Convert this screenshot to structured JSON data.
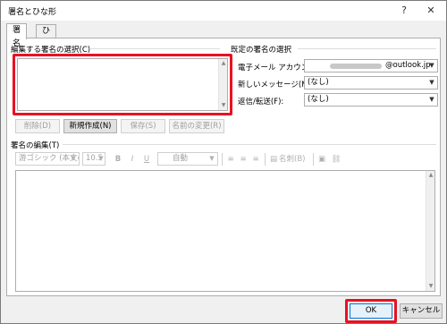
{
  "window": {
    "title": "署名とひな形",
    "help": "?",
    "close": "✕"
  },
  "tabs": [
    {
      "label": "署名"
    },
    {
      "label": "ひな形"
    }
  ],
  "select_section": {
    "title": "編集する署名の選択(C)",
    "buttons": {
      "delete": "削除(D)",
      "new": "新規作成(N)",
      "save": "保存(S)",
      "rename": "名前の変更(R)"
    }
  },
  "default_section": {
    "title": "既定の署名の選択",
    "email_label": "電子メール アカウント(A):",
    "email_value": "@outlook.jp",
    "new_msg_label": "新しいメッセージ(M):",
    "new_msg_value": "(なし)",
    "reply_label": "返信/転送(F):",
    "reply_value": "(なし)"
  },
  "edit_section": {
    "title": "署名の編集(T)",
    "font_value": "游ゴシック (本文の",
    "size_value": "10.5",
    "bold": "B",
    "italic": "I",
    "underline": "U",
    "color_value": "自動",
    "card_label": "名刺(B)"
  },
  "footer": {
    "ok": "OK",
    "cancel": "キャンセル"
  },
  "colors": {
    "highlight": "#e81123",
    "panel_border": "#adadad"
  }
}
